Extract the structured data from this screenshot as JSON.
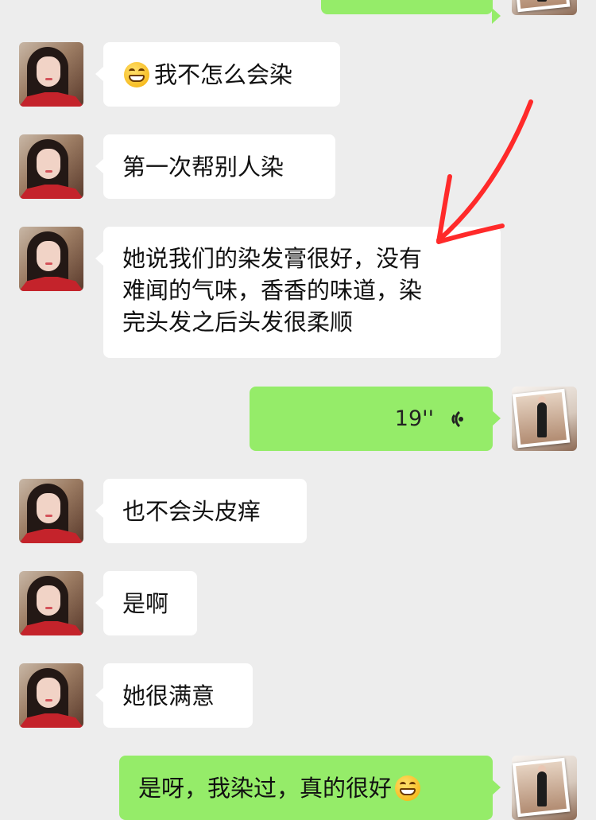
{
  "messages": [
    {
      "side": "right",
      "type": "text",
      "text": ""
    },
    {
      "side": "left",
      "type": "text",
      "emoji": "grin",
      "text": "我不怎么会染"
    },
    {
      "side": "left",
      "type": "text",
      "text": "第一次帮别人染"
    },
    {
      "side": "left",
      "type": "text",
      "lines": [
        "她说我们的染发膏很好，没有",
        "难闻的气味，香香的味道，染",
        "完头发之后头发很柔顺"
      ]
    },
    {
      "side": "right",
      "type": "voice",
      "duration": "19''"
    },
    {
      "side": "left",
      "type": "text",
      "text": "也不会头皮痒"
    },
    {
      "side": "left",
      "type": "text",
      "text": "是啊"
    },
    {
      "side": "left",
      "type": "text",
      "text": "她很满意"
    },
    {
      "side": "right",
      "type": "text",
      "text": "是呀，我染过，真的很好",
      "emoji": "grin"
    }
  ],
  "colors": {
    "background": "#ededed",
    "incoming": "#ffffff",
    "outgoing": "#95ec69",
    "annotation": "#ff2a2a"
  }
}
